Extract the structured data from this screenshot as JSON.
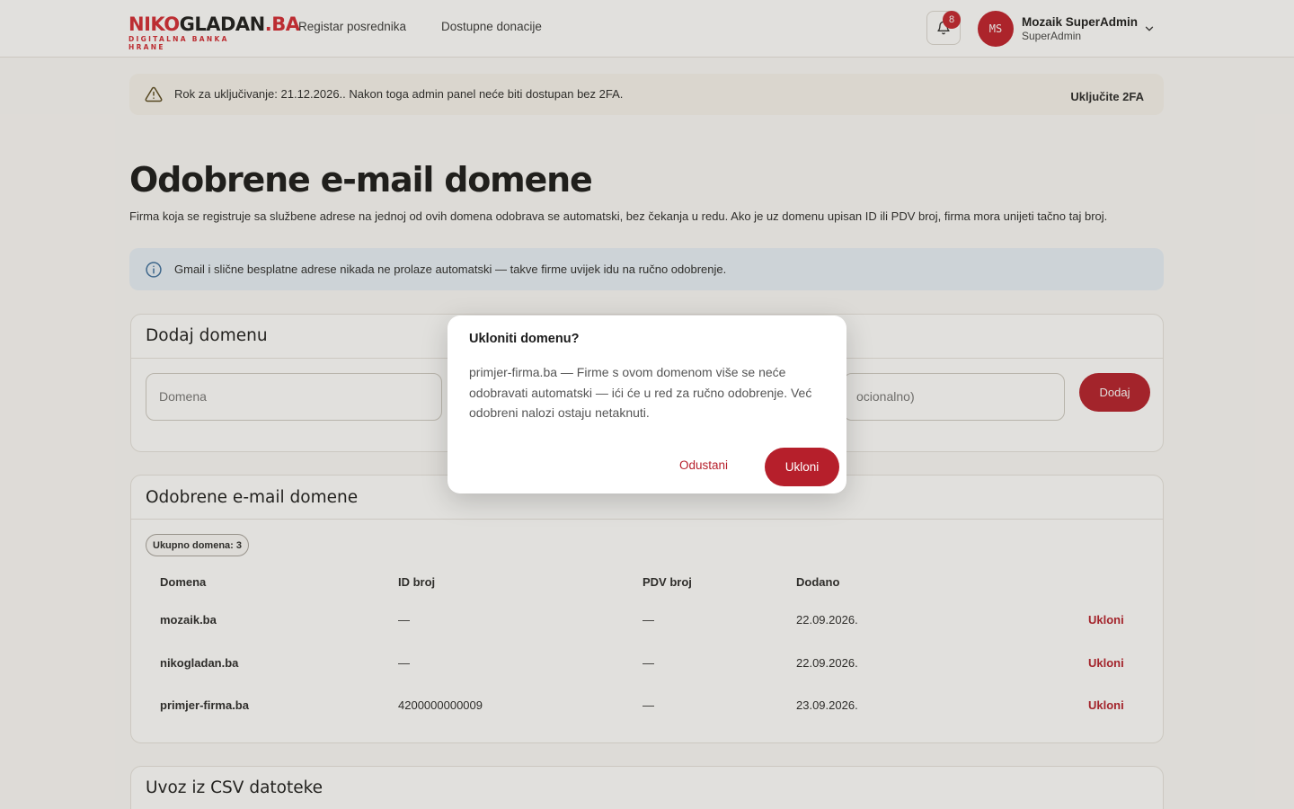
{
  "header": {
    "logo_main_red": "NIKO",
    "logo_main_dark": "GLADAN",
    "logo_main_suffix": ".BA",
    "logo_sub": "DIGITALNA BANKA HRANE",
    "nav": [
      "Registar posrednika",
      "Dostupne donacije"
    ],
    "notifications_count": "8",
    "avatar_initials": "MS",
    "user_name": "Mozaik SuperAdmin",
    "user_role": "SuperAdmin"
  },
  "warning": {
    "text": "Rok za uključivanje: 21.12.2026.. Nakon toga admin panel neće biti dostupan bez 2FA.",
    "action": "Uključite 2FA"
  },
  "page": {
    "title": "Odobrene e-mail domene",
    "description": "Firma koja se registruje sa službene adrese na jednoj od ovih domena odobrava se automatski, bez čekanja u redu. Ako je uz domenu upisan ID ili PDV broj, firma mora unijeti tačno taj broj."
  },
  "info": {
    "text": "Gmail i slične besplatne adrese nikada ne prolaze automatski — takve firme uvijek idu na ručno odobrenje."
  },
  "add_card": {
    "title": "Dodaj domenu",
    "domain_placeholder": "Domena",
    "pdv_placeholder_visible": "ocionalno)",
    "add_label": "Dodaj"
  },
  "list_card": {
    "title": "Odobrene e-mail domene",
    "count_label": "Ukupno domena: 3",
    "columns": [
      "Domena",
      "ID broj",
      "PDV broj",
      "Dodano"
    ],
    "rows": [
      {
        "domain": "mozaik.ba",
        "id": "—",
        "pdv": "—",
        "added": "22.09.2026.",
        "action": "Ukloni"
      },
      {
        "domain": "nikogladan.ba",
        "id": "—",
        "pdv": "—",
        "added": "22.09.2026.",
        "action": "Ukloni"
      },
      {
        "domain": "primjer-firma.ba",
        "id": "4200000000009",
        "pdv": "—",
        "added": "23.09.2026.",
        "action": "Ukloni"
      }
    ]
  },
  "csv_card": {
    "title": "Uvoz iz CSV datoteke"
  },
  "modal": {
    "title": "Ukloniti domenu?",
    "body": "primjer-firma.ba — Firme s ovom domenom više se neće odobravati automatski — ići će u red za ručno odobrenje. Već odobreni nalozi ostaju netaknuti.",
    "cancel_label": "Odustani",
    "confirm_label": "Ukloni"
  },
  "colors": {
    "accent": "#b61f2b",
    "brand_red": "#d32a34",
    "info_bg": "#e8f0f8",
    "warning_bg": "#f7f4ee"
  },
  "icons": {
    "warning": "warning-triangle-icon",
    "info": "info-circle-icon",
    "bell": "bell-icon",
    "chevron": "chevron-down-icon"
  }
}
